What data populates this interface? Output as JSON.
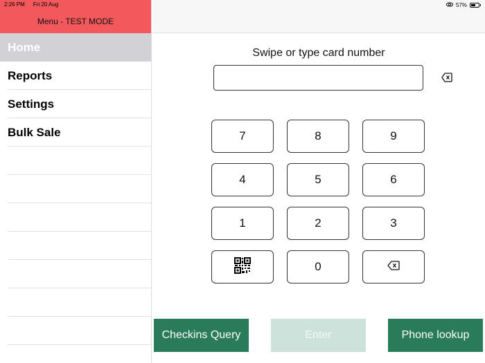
{
  "status_bar": {
    "time": "2:26 PM",
    "date": "Fri 20 Aug",
    "battery": "57%"
  },
  "sidebar": {
    "header": "Menu - TEST MODE",
    "items": [
      {
        "label": "Home",
        "active": true
      },
      {
        "label": "Reports",
        "active": false
      },
      {
        "label": "Settings",
        "active": false
      },
      {
        "label": "Bulk Sale",
        "active": false
      }
    ]
  },
  "main": {
    "prompt": "Swipe or type card number",
    "card_input": {
      "value": "",
      "placeholder": ""
    },
    "keypad": {
      "k7": "7",
      "k8": "8",
      "k9": "9",
      "k4": "4",
      "k5": "5",
      "k6": "6",
      "k1": "1",
      "k2": "2",
      "k3": "3",
      "k0": "0"
    },
    "buttons": {
      "checkins_query": "Checkins Query",
      "enter": "Enter",
      "phone_lookup": "Phone lookup"
    }
  },
  "colors": {
    "header_red": "#f2585c",
    "accent_green": "#2a7b5a",
    "disabled_green": "#cde2da",
    "active_menu_bg": "#d1d1d6"
  }
}
